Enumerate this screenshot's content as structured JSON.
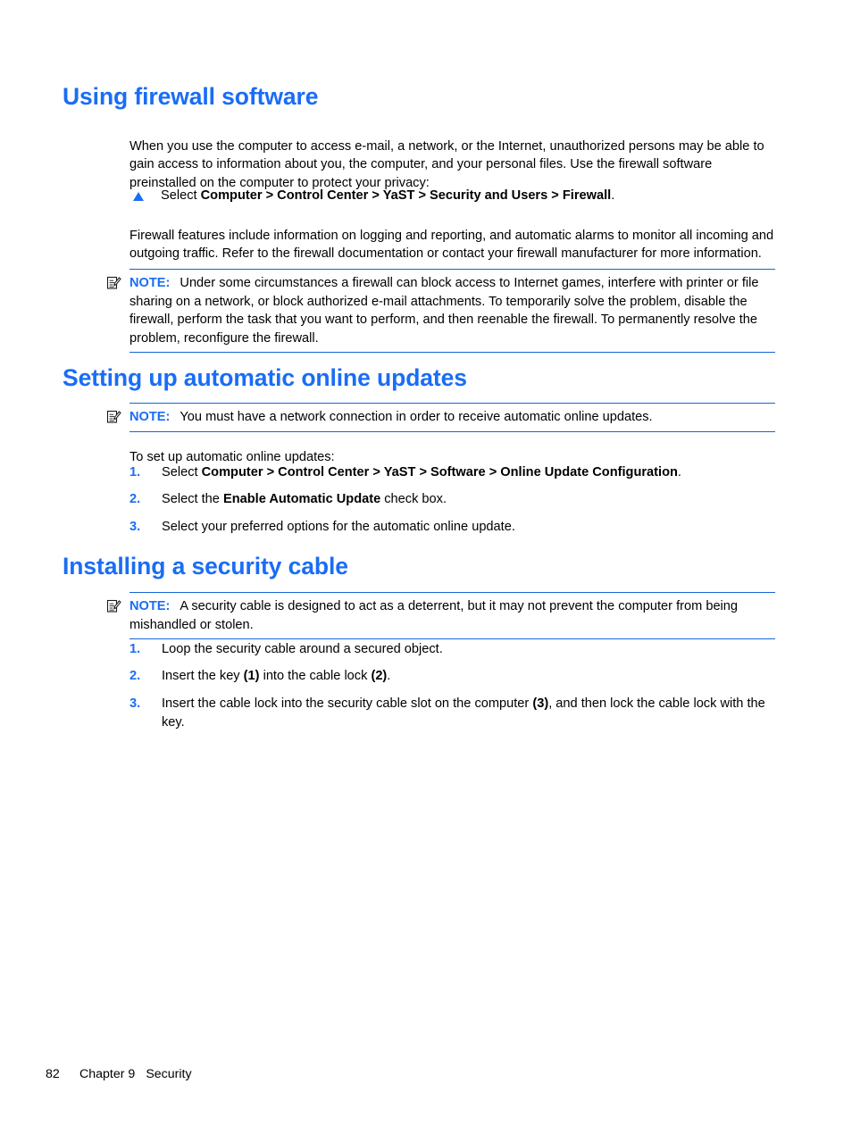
{
  "document": {
    "footer": {
      "page_number": "82",
      "chapter": "Chapter 9",
      "chapter_title": "Security"
    },
    "colors": {
      "heading_blue": "#1a6df5",
      "note_rule_blue": "#1565d8",
      "body_black": "#000000"
    }
  },
  "sections": {
    "firewall": {
      "heading": "Using firewall software",
      "intro_paragraph": "When you use the computer to access e-mail, a network, or the Internet, unauthorized persons may be able to gain access to information about you, the computer, and your personal files. Use the firewall software preinstalled on the computer to protect your privacy:",
      "bullet": {
        "marker_icon": "triangle-bullet-icon",
        "prefix": "Select ",
        "path": "Computer > Control Center > YaST > Security and Users > Firewall",
        "suffix": "."
      },
      "features_paragraph": "Firewall features include information on logging and reporting, and automatic alarms to monitor all incoming and outgoing traffic. Refer to the firewall documentation or contact your firewall manufacturer for more information.",
      "note": {
        "icon": "note-pencil-icon",
        "label": "NOTE:",
        "text": "Under some circumstances a firewall can block access to Internet games, interfere with printer or file sharing on a network, or block authorized e-mail attachments. To temporarily solve the problem, disable the firewall, perform the task that you want to perform, and then reenable the firewall. To permanently resolve the problem, reconfigure the firewall."
      }
    },
    "online_updates": {
      "heading": "Setting up automatic online updates",
      "note": {
        "icon": "note-pencil-icon",
        "label": "NOTE:",
        "text": "You must have a network connection in order to receive automatic online updates."
      },
      "lead_in": "To set up automatic online updates:",
      "steps": [
        {
          "number": "1.",
          "before": "Select ",
          "bold": "Computer > Control Center > YaST > Software > Online Update Configuration",
          "after": "."
        },
        {
          "number": "2.",
          "before": "Select the ",
          "bold": "Enable Automatic Update",
          "after": " check box."
        },
        {
          "number": "3.",
          "before": "Select your preferred options for the automatic online update.",
          "bold": "",
          "after": ""
        }
      ]
    },
    "security_cable": {
      "heading": "Installing a security cable",
      "note": {
        "icon": "note-pencil-icon",
        "label": "NOTE:",
        "text": "A security cable is designed to act as a deterrent, but it may not prevent the computer from being mishandled or stolen."
      },
      "steps": [
        {
          "number": "1.",
          "before": "Loop the security cable around a secured object.",
          "bold": "",
          "after": ""
        },
        {
          "number": "2.",
          "before": "Insert the key ",
          "bold": "(1)",
          "mid": " into the cable lock ",
          "bold2": "(2)",
          "after": "."
        },
        {
          "number": "3.",
          "before": "Insert the cable lock into the security cable slot on the computer ",
          "bold": "(3)",
          "after": ", and then lock the cable lock with the key."
        }
      ]
    }
  }
}
